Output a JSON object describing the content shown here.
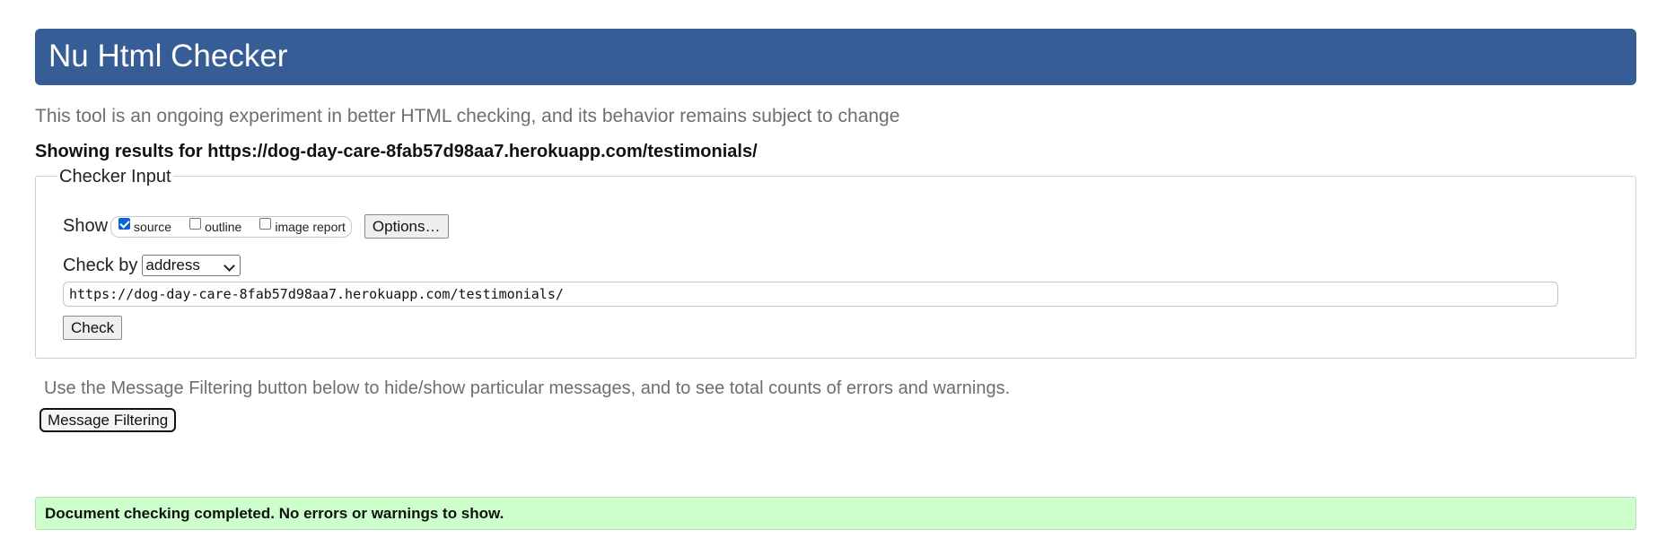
{
  "header": {
    "title": "Nu Html Checker"
  },
  "tagline": "This tool is an ongoing experiment in better HTML checking, and its behavior remains subject to change",
  "results_for": "Showing results for https://dog-day-care-8fab57d98aa7.herokuapp.com/testimonials/",
  "checker_input": {
    "legend": "Checker Input",
    "show_label": "Show",
    "show_options": [
      {
        "label": "source",
        "checked": true
      },
      {
        "label": "outline",
        "checked": false
      },
      {
        "label": "image report",
        "checked": false
      }
    ],
    "options_button": "Options…",
    "check_by_label": "Check by",
    "check_by_selected": "address",
    "url_value": "https://dog-day-care-8fab57d98aa7.herokuapp.com/testimonials/",
    "check_button": "Check"
  },
  "filter": {
    "note": "Use the Message Filtering button below to hide/show particular messages, and to see total counts of errors and warnings.",
    "button": "Message Filtering"
  },
  "status": {
    "message": "Document checking completed. No errors or warnings to show.",
    "color": "#ccffcc"
  },
  "colors": {
    "banner": "#365d95",
    "checkbox_checked": "#0a63d6"
  }
}
